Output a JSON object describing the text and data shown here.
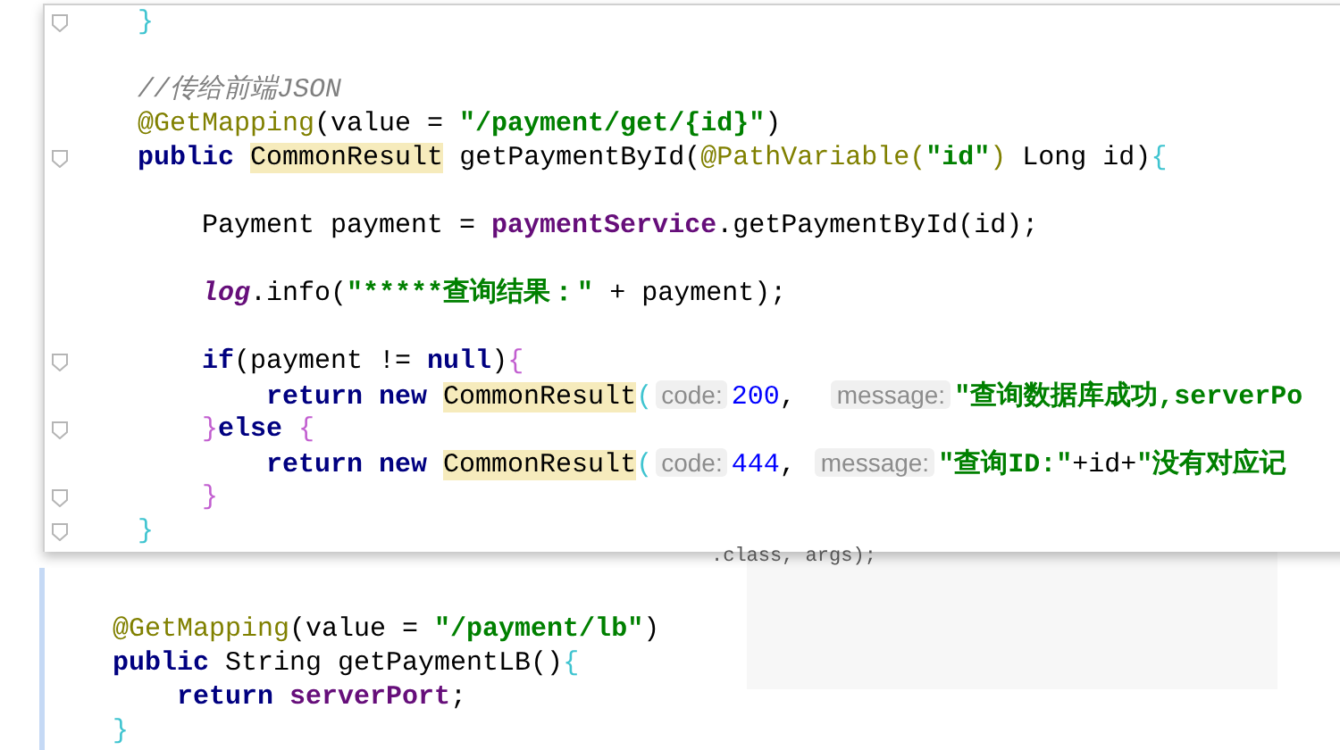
{
  "background_editor": {
    "line": ".class, args);"
  },
  "popup": {
    "lines": [
      {
        "fold": true,
        "tokens": [
          {
            "text": "    }",
            "kind": "brace_cyan"
          }
        ]
      },
      {
        "fold": false
      },
      {
        "fold": false,
        "tokens": [
          {
            "text": "    //传给前端JSON",
            "kind": "comment"
          }
        ]
      },
      {
        "fold": false,
        "tokens": [
          {
            "text": "    @GetMapping",
            "kind": "annotation"
          },
          {
            "text": "(value = ",
            "kind": "plain"
          },
          {
            "text": "\"/payment/get/{id}\"",
            "kind": "string"
          },
          {
            "text": ")",
            "kind": "plain"
          }
        ]
      },
      {
        "fold": true,
        "tokens": [
          {
            "text": "    public ",
            "kind": "keyword"
          },
          {
            "text": "CommonResult",
            "kind": "type_highlight"
          },
          {
            "text": " getPaymentById(",
            "kind": "plain"
          },
          {
            "text": "@PathVariable",
            "kind": "annotation"
          },
          {
            "text": "(",
            "kind": "annotation"
          },
          {
            "text": "\"id\"",
            "kind": "string"
          },
          {
            "text": ")",
            "kind": "annotation"
          },
          {
            "text": " Long id)",
            "kind": "plain"
          },
          {
            "text": "{",
            "kind": "brace_cyan"
          }
        ]
      },
      {
        "fold": false
      },
      {
        "fold": false,
        "tokens": [
          {
            "text": "        Payment payment = ",
            "kind": "plain"
          },
          {
            "text": "paymentService",
            "kind": "field"
          },
          {
            "text": ".getPaymentById(id);",
            "kind": "plain"
          }
        ]
      },
      {
        "fold": false
      },
      {
        "fold": false,
        "tokens": [
          {
            "text": "        log",
            "kind": "static_field"
          },
          {
            "text": ".info(",
            "kind": "plain"
          },
          {
            "text": "\"*****查询结果：\"",
            "kind": "string"
          },
          {
            "text": " + payment);",
            "kind": "plain"
          }
        ]
      },
      {
        "fold": false
      },
      {
        "fold": true,
        "tokens": [
          {
            "text": "        if",
            "kind": "keyword"
          },
          {
            "text": "(payment != ",
            "kind": "plain"
          },
          {
            "text": "null",
            "kind": "keyword"
          },
          {
            "text": ")",
            "kind": "plain"
          },
          {
            "text": "{",
            "kind": "brace_purple"
          }
        ]
      },
      {
        "fold": false,
        "tokens": [
          {
            "text": "            return new ",
            "kind": "keyword"
          },
          {
            "text": "CommonResult",
            "kind": "type_highlight"
          },
          {
            "text": "(",
            "kind": "brace_cyan"
          },
          {
            "text": "code:",
            "kind": "hint"
          },
          {
            "text": "200",
            "kind": "number"
          },
          {
            "text": ",  ",
            "kind": "plain"
          },
          {
            "text": "message:",
            "kind": "hint"
          },
          {
            "text": "\"查询数据库成功,serverPo",
            "kind": "string"
          }
        ]
      },
      {
        "fold": true,
        "tokens": [
          {
            "text": "        }",
            "kind": "brace_purple"
          },
          {
            "text": "else ",
            "kind": "keyword"
          },
          {
            "text": "{",
            "kind": "brace_purple"
          }
        ]
      },
      {
        "fold": false,
        "tokens": [
          {
            "text": "            return new ",
            "kind": "keyword"
          },
          {
            "text": "CommonResult",
            "kind": "type_highlight"
          },
          {
            "text": "(",
            "kind": "brace_cyan"
          },
          {
            "text": "code:",
            "kind": "hint"
          },
          {
            "text": "444",
            "kind": "number"
          },
          {
            "text": ", ",
            "kind": "plain"
          },
          {
            "text": "message:",
            "kind": "hint"
          },
          {
            "text": "\"查询ID:\"",
            "kind": "string"
          },
          {
            "text": "+id+",
            "kind": "plain"
          },
          {
            "text": "\"没有对应记",
            "kind": "string"
          }
        ]
      },
      {
        "fold": true,
        "tokens": [
          {
            "text": "        }",
            "kind": "brace_purple"
          }
        ]
      },
      {
        "fold": true,
        "tokens": [
          {
            "text": "    }",
            "kind": "brace_cyan"
          }
        ]
      }
    ]
  },
  "lower_editor": {
    "lines": [
      {
        "fold": false
      },
      {
        "fold": false,
        "tokens": [
          {
            "text": "    @GetMapping",
            "kind": "annotation"
          },
          {
            "text": "(value = ",
            "kind": "plain"
          },
          {
            "text": "\"/payment/lb\"",
            "kind": "string"
          },
          {
            "text": ")",
            "kind": "plain"
          }
        ]
      },
      {
        "fold": false,
        "tokens": [
          {
            "text": "    public ",
            "kind": "keyword"
          },
          {
            "text": "String getPaymentLB()",
            "kind": "plain"
          },
          {
            "text": "{",
            "kind": "brace_cyan"
          }
        ]
      },
      {
        "fold": false,
        "tokens": [
          {
            "text": "        return ",
            "kind": "keyword"
          },
          {
            "text": "serverPort",
            "kind": "field"
          },
          {
            "text": ";",
            "kind": "plain"
          }
        ]
      },
      {
        "fold": false,
        "tokens": [
          {
            "text": "    }",
            "kind": "brace_cyan"
          }
        ]
      }
    ]
  }
}
